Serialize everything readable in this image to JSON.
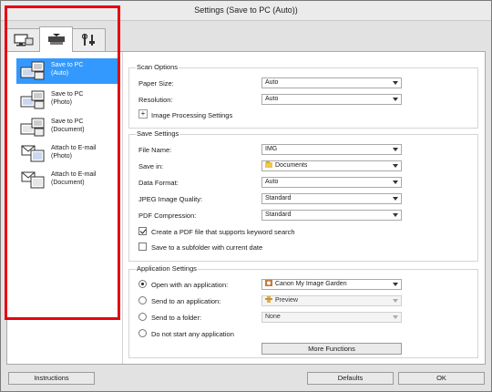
{
  "window": {
    "title": "Settings (Save to PC (Auto))"
  },
  "tabs": [
    {
      "icon": "scan-from-computer-icon"
    },
    {
      "icon": "scan-from-operation-panel-icon"
    },
    {
      "icon": "general-settings-icon"
    }
  ],
  "sidebar": {
    "items": [
      {
        "line1": "Save to PC",
        "line2": "(Auto)",
        "icon": "save-to-pc-icon",
        "selected": true
      },
      {
        "line1": "Save to PC",
        "line2": "(Photo)",
        "icon": "save-to-pc-icon"
      },
      {
        "line1": "Save to PC",
        "line2": "(Document)",
        "icon": "save-to-pc-icon"
      },
      {
        "line1": "Attach to E-mail",
        "line2": "(Photo)",
        "icon": "attach-email-icon"
      },
      {
        "line1": "Attach to E-mail",
        "line2": "(Document)",
        "icon": "attach-email-icon"
      }
    ]
  },
  "scan_options": {
    "title": "Scan Options",
    "paper_size_label": "Paper Size:",
    "paper_size_value": "Auto",
    "resolution_label": "Resolution:",
    "resolution_value": "Auto",
    "expand_symbol": "+",
    "image_processing_label": "Image Processing Settings"
  },
  "save_settings": {
    "title": "Save Settings",
    "file_name_label": "File Name:",
    "file_name_value": "IMG",
    "save_in_label": "Save in:",
    "save_in_value": "Documents",
    "data_format_label": "Data Format:",
    "data_format_value": "Auto",
    "jpeg_quality_label": "JPEG Image Quality:",
    "jpeg_quality_value": "Standard",
    "pdf_compression_label": "PDF Compression:",
    "pdf_compression_value": "Standard",
    "keyword_pdf_label": "Create a PDF file that supports keyword search",
    "keyword_pdf_checked": true,
    "subfolder_label": "Save to a subfolder with current date",
    "subfolder_checked": false
  },
  "application_settings": {
    "title": "Application Settings",
    "open_with_label": "Open with an application:",
    "open_with_value": "Canon My Image Garden",
    "send_to_app_label": "Send to an application:",
    "send_to_app_value": "Preview",
    "send_to_folder_label": "Send to a folder:",
    "send_to_folder_value": "None",
    "no_app_label": "Do not start any application",
    "more_functions_label": "More Functions",
    "selected_option": "open_with"
  },
  "footer": {
    "instructions_label": "Instructions",
    "defaults_label": "Defaults",
    "ok_label": "OK"
  },
  "colors": {
    "selection": "#3399ff",
    "highlight_box": "#e60012"
  }
}
